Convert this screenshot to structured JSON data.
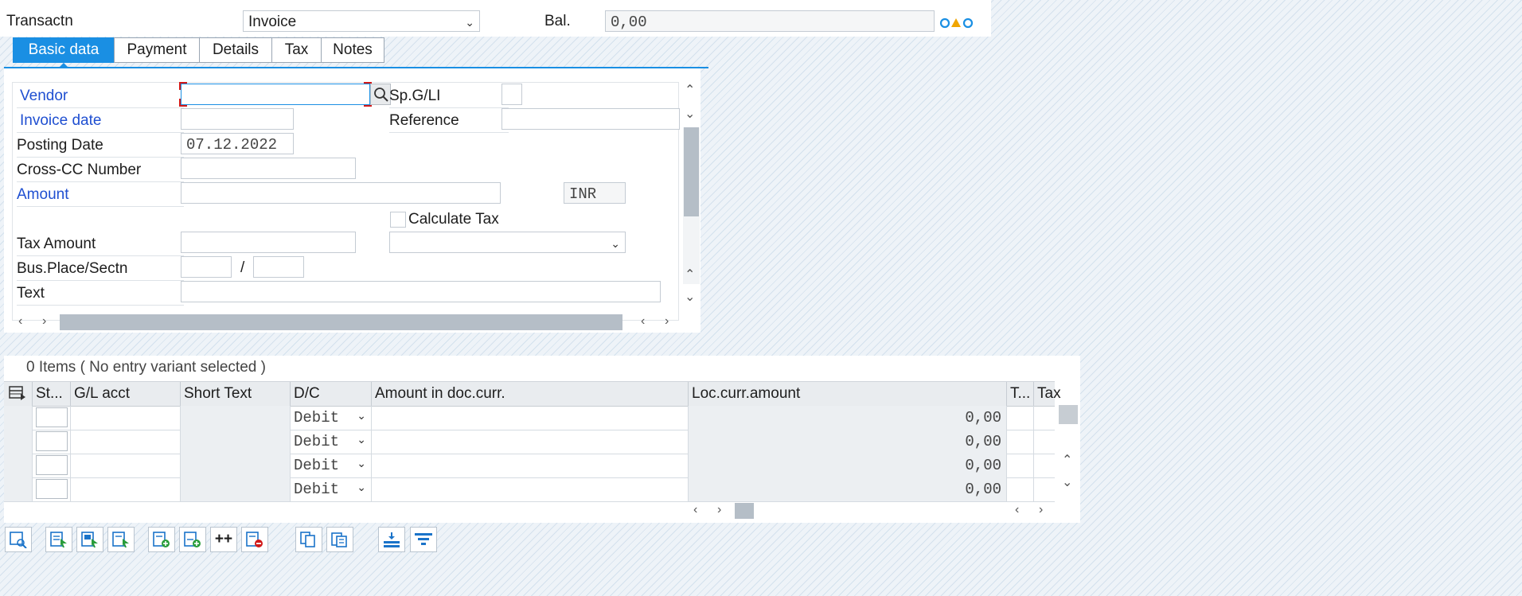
{
  "header": {
    "transaction_label": "Transactn",
    "transaction_value": "Invoice",
    "balance_label": "Bal.",
    "balance_value": "0,00"
  },
  "tabs": [
    {
      "label": "Basic data",
      "active": true
    },
    {
      "label": "Payment",
      "active": false
    },
    {
      "label": "Details",
      "active": false
    },
    {
      "label": "Tax",
      "active": false
    },
    {
      "label": "Notes",
      "active": false
    }
  ],
  "form": {
    "vendor_label": "Vendor",
    "vendor_value": "",
    "spgl_label": "Sp.G/LI",
    "invoice_date_label": "Invoice date",
    "invoice_date_value": "",
    "reference_label": "Reference",
    "posting_date_label": "Posting Date",
    "posting_date_value": "07.12.2022",
    "crosscc_label": "Cross-CC Number",
    "amount_label": "Amount",
    "currency_value": "INR",
    "calculate_tax_label": "Calculate Tax",
    "calculate_tax_checked": false,
    "tax_amount_label": "Tax Amount",
    "bus_place_label": "Bus.Place/Sectn",
    "bus_sep": "/",
    "text_label": "Text"
  },
  "items": {
    "summary": "0 Items ( No entry variant selected )",
    "columns": [
      "St...",
      "G/L acct",
      "Short Text",
      "D/C",
      "Amount in doc.curr.",
      "Loc.curr.amount",
      "T...",
      "Tax"
    ],
    "rows": [
      {
        "dc": "Debit",
        "loc_amount": "0,00"
      },
      {
        "dc": "Debit",
        "loc_amount": "0,00"
      },
      {
        "dc": "Debit",
        "loc_amount": "0,00"
      },
      {
        "dc": "Debit",
        "loc_amount": "0,00"
      }
    ]
  },
  "toolbar": {
    "icons": [
      "select-layout-icon",
      "select-all-icon",
      "select-block-icon",
      "deselect-icon",
      "insert-row-icon",
      "add-row-icon",
      "copy-plus-icon",
      "delete-row-icon",
      "copy-icon",
      "paste-icon",
      "sort-icon",
      "filter-icon"
    ],
    "plus_plus": "++"
  },
  "colors": {
    "accent": "#1a8fe3",
    "required_label": "#1f4fd1",
    "vendor_field_marker": "#d11a1a",
    "status_warning": "#f0a500",
    "status_info": "#1a8fe3"
  }
}
